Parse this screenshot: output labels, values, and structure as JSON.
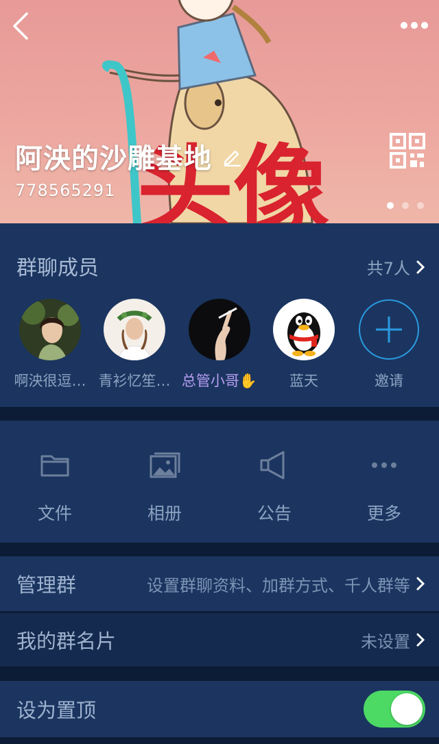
{
  "header": {
    "group_name": "阿泱的沙雕基地",
    "group_id": "778565291",
    "banner_text": "头像",
    "carousel_dots": 3,
    "carousel_active": 0
  },
  "members": {
    "title": "群聊成员",
    "count_label": "共7人",
    "list": [
      {
        "name": "啊泱很逗…",
        "icon": "avatar-girl-icon",
        "role": "member"
      },
      {
        "name": "青衫忆笙…",
        "icon": "avatar-girl-wreath-icon",
        "role": "member"
      },
      {
        "name": "总管小哥",
        "icon": "avatar-hand-cigarette-icon",
        "role": "admin"
      },
      {
        "name": "蓝天",
        "icon": "qq-penguin-icon",
        "role": "member"
      },
      {
        "name": "邀请",
        "icon": "plus-icon",
        "role": "invite"
      }
    ]
  },
  "functions": [
    {
      "label": "文件",
      "icon": "folder-icon"
    },
    {
      "label": "相册",
      "icon": "album-icon"
    },
    {
      "label": "公告",
      "icon": "megaphone-icon"
    },
    {
      "label": "更多",
      "icon": "more-dots-icon"
    }
  ],
  "rows": {
    "admin": {
      "label": "管理群",
      "value": "设置群聊资料、加群方式、千人群等"
    },
    "card": {
      "label": "我的群名片",
      "value": "未设置"
    },
    "pin": {
      "label": "设为置顶",
      "toggle_on": true
    }
  },
  "colors": {
    "card_bg": "#1b3560",
    "page_bg": "#0d1c36",
    "toggle_on": "#4cd964",
    "admin_name": "#b59ef0",
    "invite_accent": "#2a9be0"
  }
}
